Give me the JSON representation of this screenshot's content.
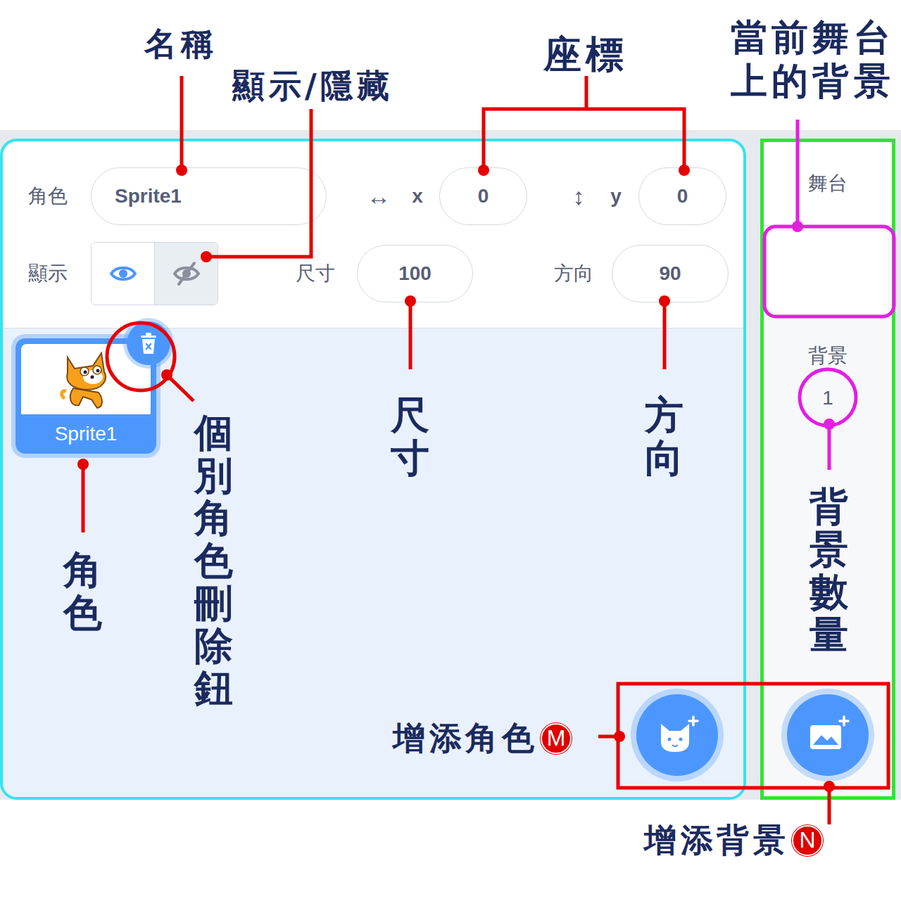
{
  "sprite_info": {
    "name_label": "角色",
    "name_value": "Sprite1",
    "x_icon": "↔",
    "x_label": "x",
    "x_value": "0",
    "y_icon": "↕",
    "y_label": "y",
    "y_value": "0",
    "show_label": "顯示",
    "visible": true,
    "size_label": "尺寸",
    "size_value": "100",
    "direction_label": "方向",
    "direction_value": "90"
  },
  "sprites": [
    {
      "name": "Sprite1",
      "selected": true
    }
  ],
  "stage": {
    "title": "舞台",
    "backdrops_label": "背景",
    "backdrop_count": "1"
  },
  "annotations": [
    {
      "text": "名稱",
      "color": "#e60000"
    },
    {
      "text": "顯示/隱藏",
      "color": "#e60000"
    },
    {
      "text": "座標",
      "color": "#e60000"
    },
    {
      "text": "當前舞台上的背景",
      "color": "#e41ee4"
    },
    {
      "text": "個別角色刪除鈕",
      "color": "#e60000"
    },
    {
      "text": "尺寸",
      "color": "#e60000"
    },
    {
      "text": "方向",
      "color": "#e60000"
    },
    {
      "text": "角色",
      "color": "#e60000"
    },
    {
      "text": "背景數量",
      "color": "#e41ee4"
    },
    {
      "text": "增添角色",
      "badge": "M",
      "color": "#e60000"
    },
    {
      "text": "增添背景",
      "badge": "N",
      "color": "#e60000"
    }
  ]
}
